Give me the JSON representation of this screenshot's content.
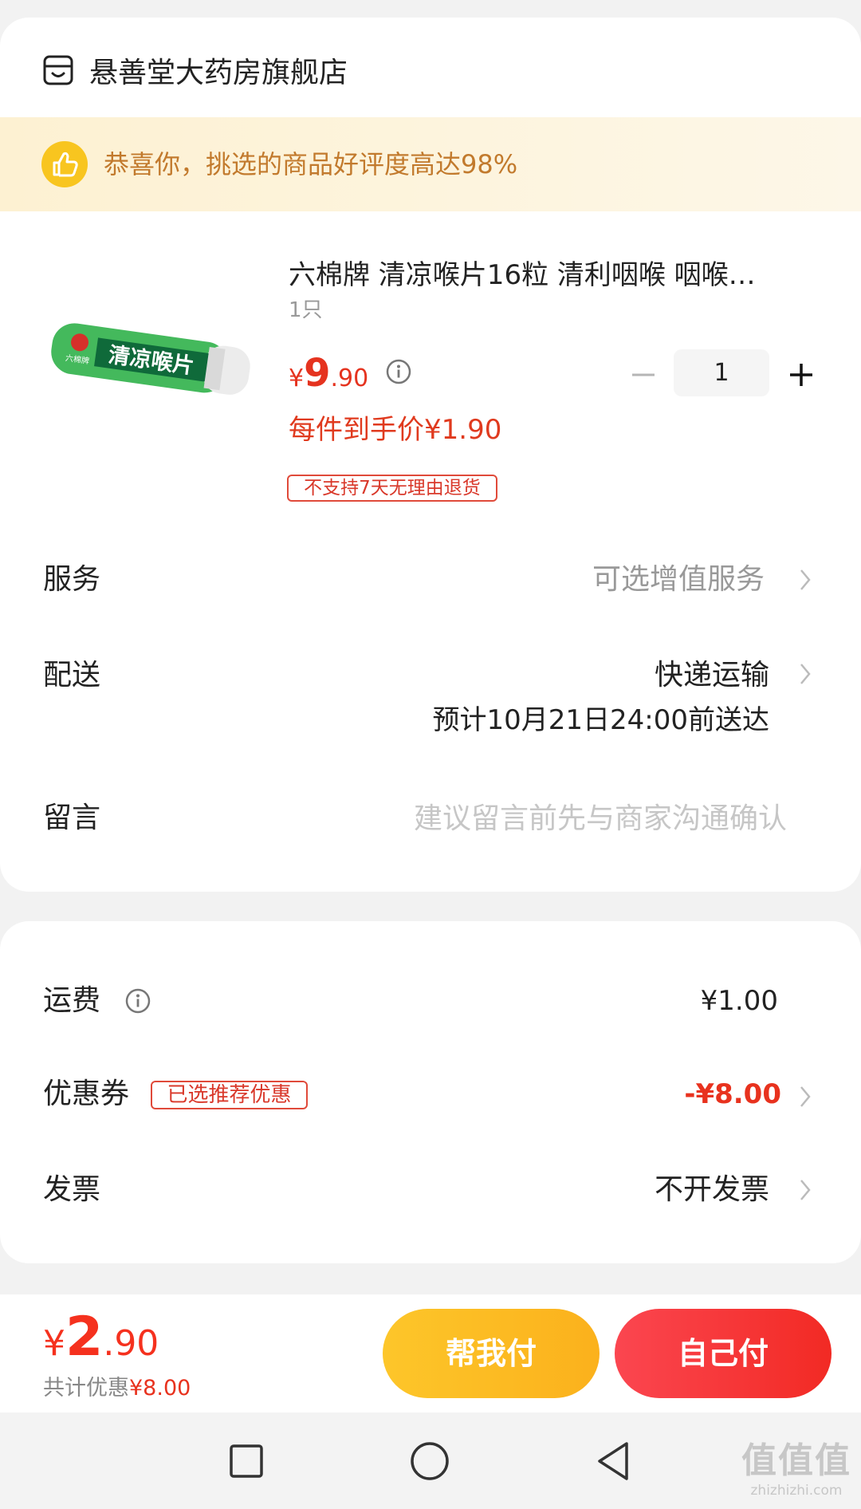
{
  "store": {
    "name": "悬善堂大药房旗舰店",
    "icon": "store-icon"
  },
  "banner": {
    "text": "恭喜你，挑选的商品好评度高达98%",
    "icon": "thumbs-up-icon"
  },
  "product": {
    "image_brand": "六棉牌",
    "image_label": "清凉喉片",
    "title": "六棉牌 清凉喉片16粒 清利咽喉 咽喉…",
    "spec": "1只",
    "price_symbol": "¥",
    "price_int": "9",
    "price_dec": ".90",
    "unit_price": "每件到手价¥1.90",
    "quantity": "1",
    "tag": "不支持7天无理由退货"
  },
  "rows": {
    "service": {
      "label": "服务",
      "value": "可选增值服务"
    },
    "delivery": {
      "label": "配送",
      "value": "快递运输",
      "eta": "预计10月21日24:00前送达"
    },
    "message": {
      "label": "留言",
      "placeholder": "建议留言前先与商家沟通确认"
    }
  },
  "summary": {
    "shipping": {
      "label": "运费",
      "value": "¥1.00"
    },
    "coupon": {
      "label": "优惠券",
      "tag": "已选推荐优惠",
      "value": "-¥8.00"
    },
    "invoice": {
      "label": "发票",
      "value": "不开发票"
    }
  },
  "footer": {
    "symbol": "¥",
    "int": "2",
    "dec": ".90",
    "discount_label": "共计优惠",
    "discount_value": "¥8.00",
    "help_pay": "帮我付",
    "self_pay": "自己付"
  },
  "watermark": {
    "brand": "值值值",
    "site": "zhizhizhi.com"
  },
  "colors": {
    "accent_red": "#e8321e",
    "banner_text": "#c27a2d",
    "banner_bg": "#fdf4d9",
    "help_pay_button": "#fcbd22",
    "self_pay_button": "#f5303a",
    "page_bg": "#f2f2f2"
  }
}
